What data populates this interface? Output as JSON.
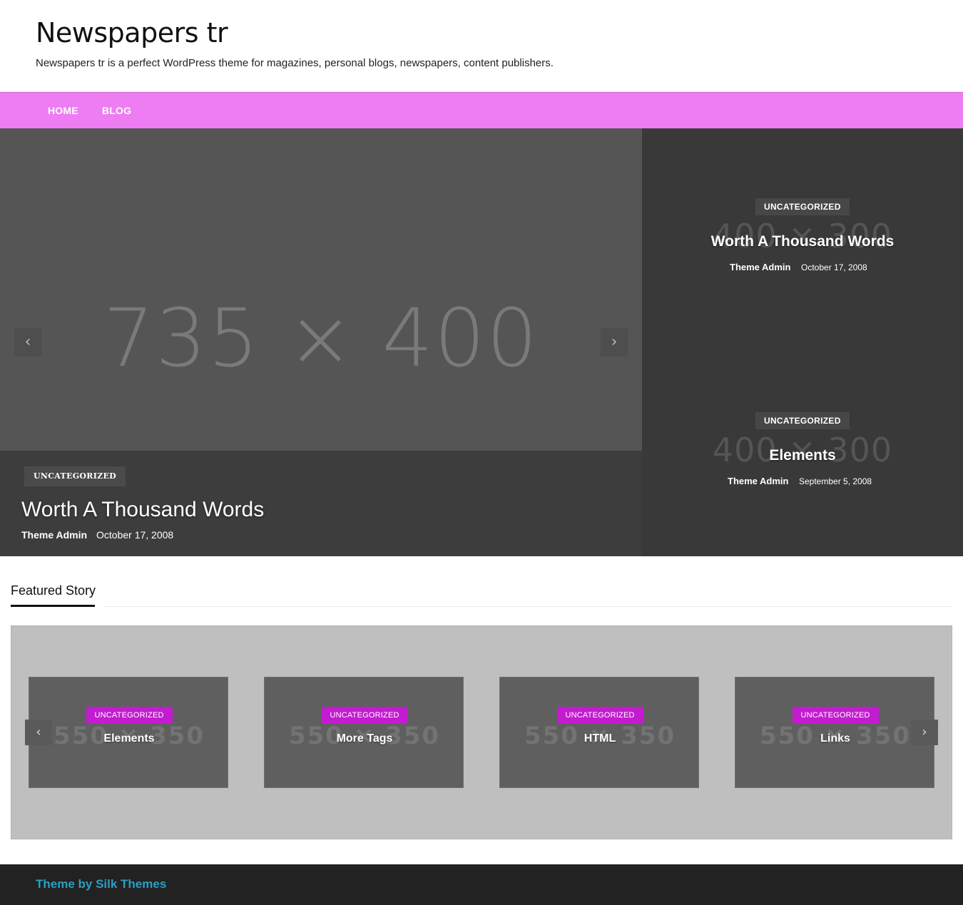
{
  "site": {
    "title": "Newspapers tr",
    "description": "Newspapers tr is a perfect WordPress theme for magazines, personal blogs, newspapers, content publishers."
  },
  "nav": {
    "items": [
      {
        "label": "HOME"
      },
      {
        "label": "BLOG"
      }
    ],
    "color": "#ee7cf2"
  },
  "hero": {
    "placeholder": "735 × 400",
    "category": "UNCATEGORIZED",
    "title": "Worth A Thousand Words",
    "author": "Theme Admin",
    "date": "October 17, 2008",
    "prev_icon": "chevron-left-icon",
    "next_icon": "chevron-right-icon"
  },
  "side_posts": [
    {
      "placeholder": "400 × 300",
      "category": "UNCATEGORIZED",
      "title": "Worth A Thousand Words",
      "author": "Theme Admin",
      "date": "October 17, 2008"
    },
    {
      "placeholder": "400 × 300",
      "category": "UNCATEGORIZED",
      "title": "Elements",
      "author": "Theme Admin",
      "date": "September 5, 2008"
    }
  ],
  "featured": {
    "heading": "Featured Story",
    "cards": [
      {
        "placeholder": "550 × 350",
        "category": "UNCATEGORIZED",
        "title": "Elements"
      },
      {
        "placeholder": "550 × 350",
        "category": "UNCATEGORIZED",
        "title": "More Tags"
      },
      {
        "placeholder": "550 × 350",
        "category": "UNCATEGORIZED",
        "title": "HTML"
      },
      {
        "placeholder": "550 × 350",
        "category": "UNCATEGORIZED",
        "title": "Links"
      }
    ],
    "category_color": "#c31bd0"
  },
  "footer": {
    "credit": "Theme by Silk Themes",
    "link_color": "#2a9fc4"
  }
}
